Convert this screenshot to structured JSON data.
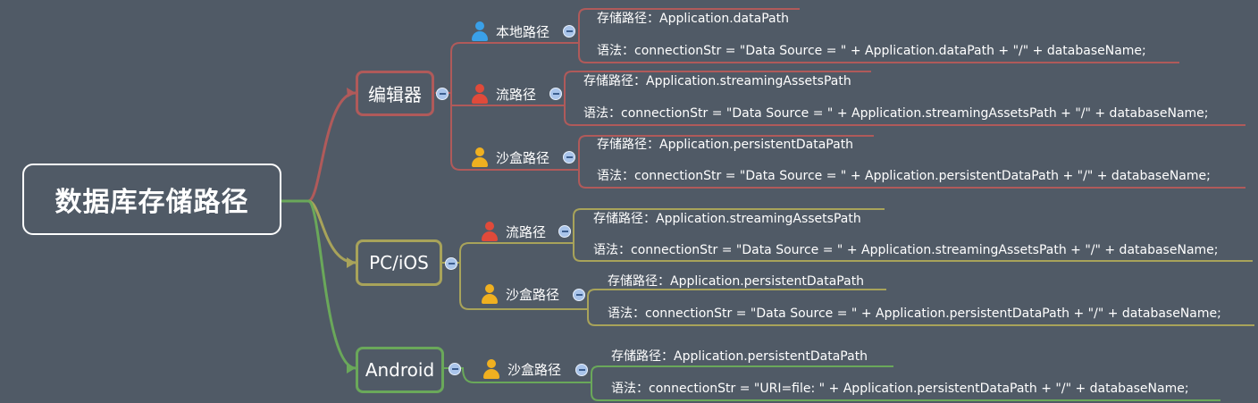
{
  "root": {
    "label": "数据库存储路径"
  },
  "colors": {
    "background": "#505a66",
    "editor": "#b05a5a",
    "pc_ios": "#a8a35a",
    "android": "#6aa85a",
    "toggle": "#a9c4ea"
  },
  "branches": [
    {
      "label": "编辑器",
      "children": [
        {
          "label": "本地路径",
          "icon": "person-blue-icon",
          "leaves": [
            "存储路径：Application.dataPath",
            "语法：connectionStr = \"Data Source = \" + Application.dataPath + \"/\" + databaseName;"
          ]
        },
        {
          "label": "流路径",
          "icon": "person-red-icon",
          "leaves": [
            "存储路径：Application.streamingAssetsPath",
            "语法：connectionStr = \"Data Source = \" + Application.streamingAssetsPath + \"/\" + databaseName;"
          ]
        },
        {
          "label": "沙盒路径",
          "icon": "person-yellow-icon",
          "leaves": [
            "存储路径：Application.persistentDataPath",
            "语法：connectionStr = \"Data Source = \" + Application.persistentDataPath + \"/\" + databaseName;"
          ]
        }
      ]
    },
    {
      "label": "PC/iOS",
      "children": [
        {
          "label": "流路径",
          "icon": "person-red-icon",
          "leaves": [
            "存储路径：Application.streamingAssetsPath",
            "语法：connectionStr = \"Data Source = \" + Application.streamingAssetsPath + \"/\" + databaseName;"
          ]
        },
        {
          "label": "沙盒路径",
          "icon": "person-yellow-icon",
          "leaves": [
            "存储路径：Application.persistentDataPath",
            "语法：connectionStr = \"Data Source = \" + Application.persistentDataPath + \"/\" + databaseName;"
          ]
        }
      ]
    },
    {
      "label": "Android",
      "children": [
        {
          "label": "沙盒路径",
          "icon": "person-yellow-icon",
          "leaves": [
            "存储路径：Application.persistentDataPath",
            "语法：connectionStr = \"URI=file: \" + Application.persistentDataPath + \"/\" + databaseName;"
          ]
        }
      ]
    }
  ]
}
